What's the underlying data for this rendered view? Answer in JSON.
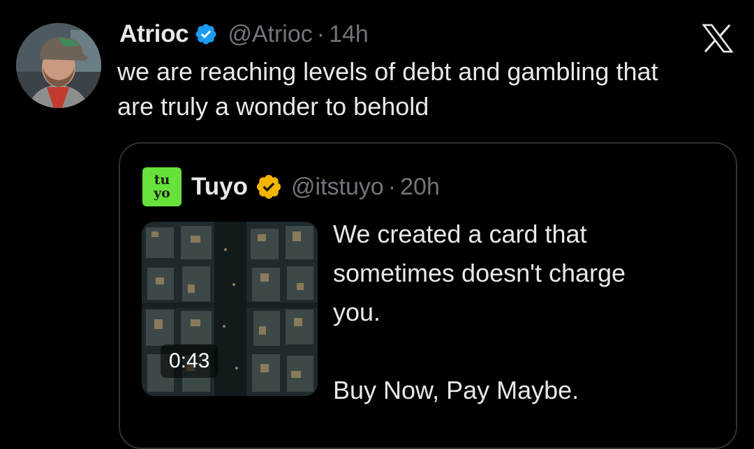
{
  "tweet": {
    "author_name": "Atrioc",
    "handle": "@Atrioc",
    "separator": "·",
    "time": "14h",
    "text_line1": "we are reaching levels of debt and gambling that",
    "text_line2": "are truly a wonder to behold",
    "avatar_icon": "user-photo-avatar",
    "verified_color": "#1d9bf0"
  },
  "quote": {
    "author_name": "Tuyo",
    "handle": "@itstuyo",
    "separator": "·",
    "time": "20h",
    "avatar_line1": "tu",
    "avatar_line2": "yo",
    "avatar_color": "#66e23a",
    "verified_color": "#f4b400",
    "text_line1": "We created a card that",
    "text_line2": "sometimes doesn't charge",
    "text_line3": "you.",
    "text_line4": "Buy Now, Pay Maybe.",
    "video_duration": "0:43",
    "video_icon": "aerial-city-video-thumbnail"
  },
  "app": {
    "logo_icon": "x-logo-icon"
  }
}
